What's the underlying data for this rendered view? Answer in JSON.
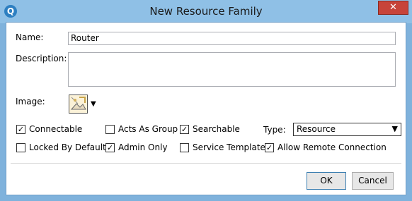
{
  "window": {
    "title": "New Resource Family",
    "app_icon_glyph": "Q",
    "close_glyph": "✕"
  },
  "form": {
    "name_label": "Name:",
    "name_value": "Router",
    "description_label": "Description:",
    "description_value": "",
    "image_label": "Image:",
    "image_dropdown_glyph": "▼",
    "type_label": "Type:",
    "type_value": "Resource",
    "type_arrow": "▼"
  },
  "checkboxes": {
    "connectable": {
      "label": "Connectable",
      "checked": true,
      "mark": "✓"
    },
    "acts_as_group": {
      "label": "Acts As Group",
      "checked": false,
      "mark": ""
    },
    "searchable": {
      "label": "Searchable",
      "checked": true,
      "mark": "✓"
    },
    "locked_by_default": {
      "label": "Locked By Default",
      "checked": false,
      "mark": ""
    },
    "admin_only": {
      "label": "Admin Only",
      "checked": true,
      "mark": "✓"
    },
    "service_template": {
      "label": "Service Template",
      "checked": false,
      "mark": ""
    },
    "allow_remote_connection": {
      "label": "Allow Remote Connection",
      "checked": true,
      "mark": "✓"
    }
  },
  "buttons": {
    "ok": "OK",
    "cancel": "Cancel"
  },
  "colors": {
    "titlebar": "#8fc0e6",
    "close_button": "#c7443a",
    "accent": "#3c7fb1"
  },
  "icons": {
    "app": "app-logo-icon",
    "close": "close-icon",
    "image": "resource-image-icon",
    "dropdown": "chevron-down-icon"
  }
}
